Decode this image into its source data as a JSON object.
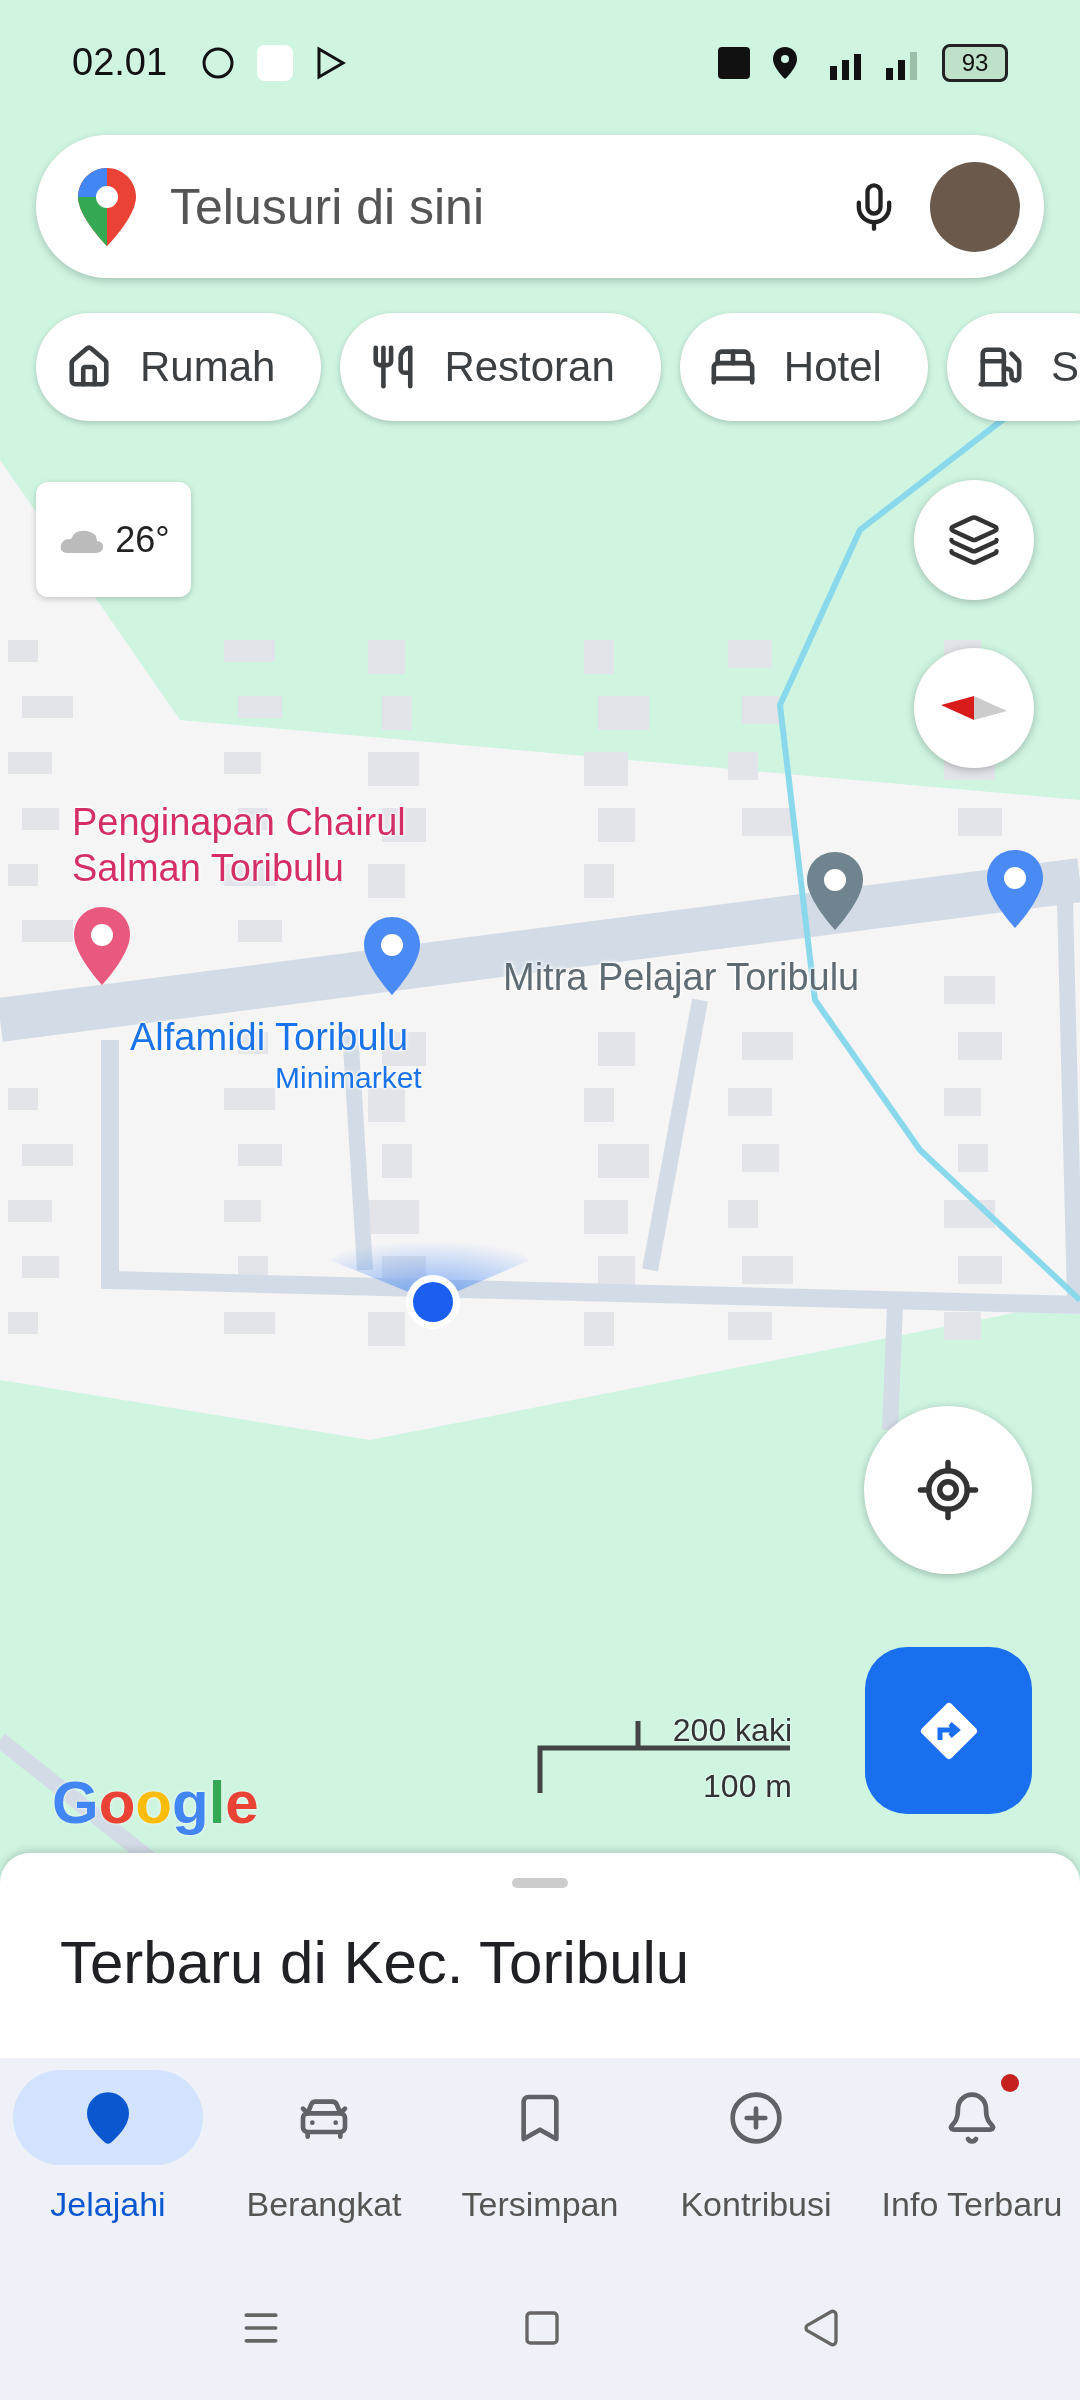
{
  "status_bar": {
    "time": "02.01",
    "battery": "93"
  },
  "search": {
    "placeholder": "Telusuri di sini"
  },
  "chips": [
    {
      "kind": "home",
      "label": "Rumah"
    },
    {
      "kind": "restaurant",
      "label": "Restoran"
    },
    {
      "kind": "hotel",
      "label": "Hotel"
    },
    {
      "kind": "fuel",
      "label": "S"
    }
  ],
  "weather": {
    "temperature": "26°"
  },
  "map": {
    "places": [
      {
        "kind": "hotel",
        "name": "Penginapan Chairul Salman Toribulu"
      },
      {
        "kind": "store",
        "name": "Alfamidi Toribulu",
        "category": "Minimarket"
      },
      {
        "kind": "school",
        "name": "Mitra Pelajar Toribulu"
      },
      {
        "kind": "shop"
      }
    ],
    "scale": {
      "imperial": "200 kaki",
      "metric": "100 m"
    },
    "logo": "Google"
  },
  "sheet": {
    "title": "Terbaru di Kec. Toribulu"
  },
  "nav": [
    {
      "kind": "explore",
      "label": "Jelajahi",
      "selected": true,
      "badge": false
    },
    {
      "kind": "go",
      "label": "Berangkat",
      "selected": false,
      "badge": false
    },
    {
      "kind": "saved",
      "label": "Tersimpan",
      "selected": false,
      "badge": false
    },
    {
      "kind": "contribute",
      "label": "Kontribusi",
      "selected": false,
      "badge": false
    },
    {
      "kind": "updates",
      "label": "Info Terbaru",
      "selected": false,
      "badge": true
    }
  ]
}
